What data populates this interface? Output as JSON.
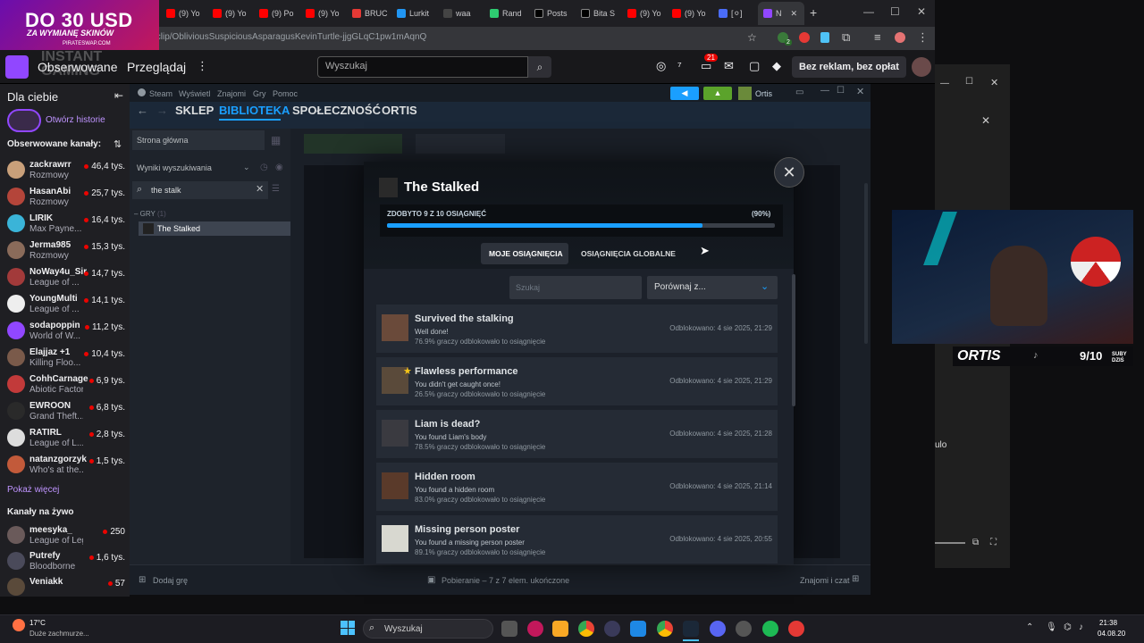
{
  "promo": {
    "big": "DO 30 USD",
    "sub": "ZA WYMIANĘ SKINÓW",
    "tiny": "PIRATESWAP.COM"
  },
  "browser": {
    "tabs": [
      "(9) Yo",
      "(9) Yo",
      "(9) Po",
      "(9) Yo",
      "BRUC",
      "Lurkit",
      "waa",
      "Rand",
      "Posts",
      "Bita S",
      "(9) Yo",
      "(9) Yo",
      "[⚪]",
      "N"
    ],
    "url": "/clip/ObliviousSuspiciousAsparagusKevinTurtle-jjgGLqC1pw1mAqnQ",
    "ext_badge": "2"
  },
  "twitch": {
    "nav_followed": "Obserwowane",
    "nav_browse": "Przeglądaj",
    "search_placeholder": "Wyszukaj",
    "notif_count": "21",
    "ad_free": "Bez reklam, bez opłat",
    "watermark": "INSTANT\nGAMING"
  },
  "sidebar": {
    "for_you": "Dla ciebie",
    "open_stories": "Otwórz historie",
    "followed_title": "Obserwowane kanały:",
    "followed": [
      {
        "name": "zackrawrr",
        "game": "Rozmowy",
        "viewers": "46,4 tys.",
        "color": "#c9a07a"
      },
      {
        "name": "HasanAbi",
        "game": "Rozmowy",
        "viewers": "25,7 tys.",
        "color": "#b4453a"
      },
      {
        "name": "LIRIK",
        "game": "Max Payne...",
        "viewers": "16,4 tys.",
        "color": "#3ab4d8"
      },
      {
        "name": "Jerma985",
        "game": "Rozmowy",
        "viewers": "15,3 tys.",
        "color": "#8a6b5a"
      },
      {
        "name": "NoWay4u_Sir",
        "game": "League of ...",
        "viewers": "14,7 tys.",
        "color": "#a23a3a"
      },
      {
        "name": "YoungMulti",
        "game": "League of ...",
        "viewers": "14,1 tys.",
        "color": "#eeeeee"
      },
      {
        "name": "sodapoppin",
        "game": "World of W...",
        "viewers": "11,2 tys.",
        "color": "#9147ff"
      },
      {
        "name": "Elajjaz +1",
        "game": "Killing Floo...",
        "viewers": "10,4 tys.",
        "color": "#7a5a4a"
      },
      {
        "name": "CohhCarnage",
        "game": "Abiotic Factor",
        "viewers": "6,9 tys.",
        "color": "#c23a3a"
      },
      {
        "name": "EWROON",
        "game": "Grand Theft...",
        "viewers": "6,8 tys.",
        "color": "#2a2a2a"
      },
      {
        "name": "RATIRL",
        "game": "League of L...",
        "viewers": "2,8 tys.",
        "color": "#dddddd"
      },
      {
        "name": "natanzgorzyk",
        "game": "Who's at the...",
        "viewers": "1,5 tys.",
        "color": "#c25a3a"
      }
    ],
    "show_more": "Pokaż więcej",
    "live_title": "Kanały na żywo",
    "live": [
      {
        "name": "meesyka_",
        "game": "League of Lege...",
        "viewers": "250",
        "color": "#6a5a5a"
      },
      {
        "name": "Putrefy",
        "game": "Bloodborne",
        "viewers": "1,6 tys.",
        "color": "#4a4a5a"
      },
      {
        "name": "Veniakk",
        "game": "",
        "viewers": "57",
        "color": "#5a4a3a"
      }
    ]
  },
  "steam": {
    "menu": [
      "Steam",
      "Wyświetl",
      "Znajomi",
      "Gry",
      "Pomoc"
    ],
    "user": "Ortis",
    "nav": [
      "SKLEP",
      "BIBLIOTEKA",
      "SPOŁECZNOŚĆ",
      "ORTIS"
    ],
    "home": "Strona główna",
    "search_results": "Wyniki wyszukiwania",
    "search_value": "the stalk",
    "group": "GRY",
    "group_count": "(1)",
    "game": "The Stalked",
    "add_game": "Dodaj grę",
    "downloads": "Pobieranie – 7 z 7 elem. ukończone",
    "friends": "Znajomi i czat"
  },
  "modal": {
    "title": "The Stalked",
    "progress_label": "ZDOBYTO 9 Z 10 OSIĄGNIĘĆ",
    "progress_pct": "(90%)",
    "progress_value": 0.9,
    "tab_mine": "MOJE OSIĄGNIĘCIA",
    "tab_global": "OSIĄGNIĘCIA GLOBALNE",
    "search_placeholder": "Szukaj",
    "compare": "Porównaj z...",
    "achievements": [
      {
        "title": "Survived the stalking",
        "desc": "Well done!",
        "pct": "76.9% graczy odblokowało to osiągnięcie",
        "unlocked": "Odblokowano: 4 sie 2025, 21:29",
        "color": "#6a4a3a"
      },
      {
        "title": "Flawless performance",
        "desc": "You didn't get caught once!",
        "pct": "26.5% graczy odblokowało to osiągnięcie",
        "unlocked": "Odblokowano: 4 sie 2025, 21:29",
        "color": "#5a4a3a"
      },
      {
        "title": "Liam is dead?",
        "desc": "You found Liam's body",
        "pct": "78.5% graczy odblokowało to osiągnięcie",
        "unlocked": "Odblokowano: 4 sie 2025, 21:28",
        "color": "#3a3a40"
      },
      {
        "title": "Hidden room",
        "desc": "You found a hidden room",
        "pct": "83.0% graczy odblokowało to osiągnięcie",
        "unlocked": "Odblokowano: 4 sie 2025, 21:14",
        "color": "#5a3a2a"
      },
      {
        "title": "Missing person poster",
        "desc": "You found a missing person poster",
        "pct": "89.1% graczy odblokowało to osiągnięcie",
        "unlocked": "Odblokowano: 4 sie 2025, 20:55",
        "color": "#d8d8d0"
      }
    ]
  },
  "cam": {
    "name": "ORTIS",
    "sub_count": "9/10",
    "sub_label": "SUBY DZIŚ"
  },
  "bgwin": {
    "text": "ulo"
  },
  "taskbar": {
    "temp": "17°C",
    "weather": "Duże zachmurze...",
    "search": "Wyszukaj",
    "time": "21:38",
    "date": "04.08.20"
  }
}
